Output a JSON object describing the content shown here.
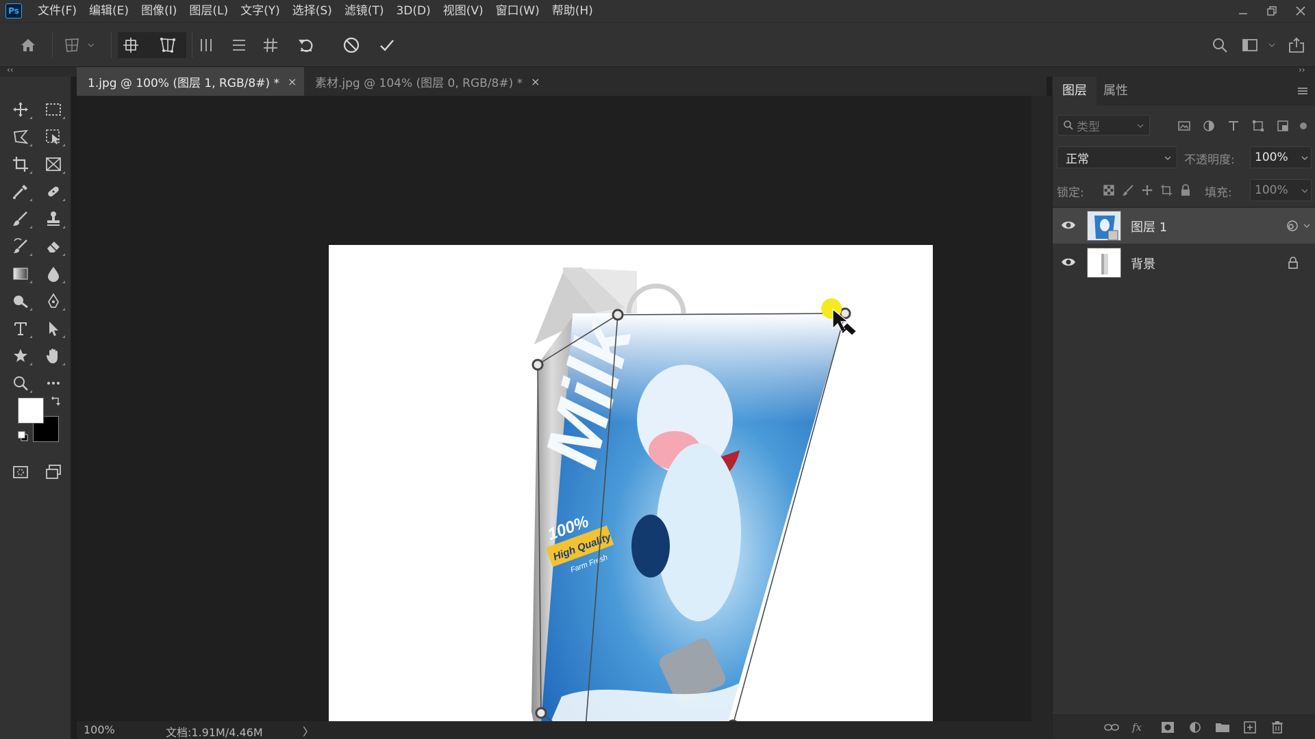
{
  "menubar": {
    "logo": "Ps",
    "items": [
      "文件(F)",
      "编辑(E)",
      "图像(I)",
      "图层(L)",
      "文字(Y)",
      "选择(S)",
      "滤镜(T)",
      "3D(D)",
      "视图(V)",
      "窗口(W)",
      "帮助(H)"
    ]
  },
  "options": {
    "icons": [
      "home-icon",
      "warp-mode-icon",
      "perspective-layout-icon",
      "perspective-warp-icon",
      "vertical-straighten-icon",
      "horizontal-straighten-icon",
      "grid-icon",
      "reset-icon",
      "cancel-icon",
      "commit-icon",
      "search-icon",
      "workspace-icon",
      "share-icon"
    ]
  },
  "collapse": {
    "left": "‹‹",
    "right": "››"
  },
  "tabs": [
    {
      "label": "1.jpg @ 100% (图层 1, RGB/8#) *",
      "close": "×"
    },
    {
      "label": "素材.jpg @ 104% (图层 0, RGB/8#) *",
      "close": "×"
    }
  ],
  "canvas": {
    "milk_text": "Milk",
    "badge_percent": "100%",
    "badge_line1": "High Quality",
    "badge_line2": "Farm Fresh"
  },
  "status": {
    "zoom": "100%",
    "doc_size": "文档:1.91M/4.46M",
    "arrow": "〉"
  },
  "colors": {
    "foreground": "#ffffff",
    "background": "#000000",
    "accent": "#31a8ff",
    "carton_blue": "#1b63b8"
  },
  "layers_panel": {
    "tabs": [
      "图层",
      "属性"
    ],
    "filter_placeholder": "类型",
    "blend_mode": "正常",
    "opacity_label": "不透明度:",
    "opacity_value": "100%",
    "lock_label": "锁定:",
    "fill_label": "填充:",
    "fill_value": "100%",
    "layers": [
      {
        "name": "图层 1",
        "selected": true
      },
      {
        "name": "背景",
        "selected": false
      }
    ]
  }
}
